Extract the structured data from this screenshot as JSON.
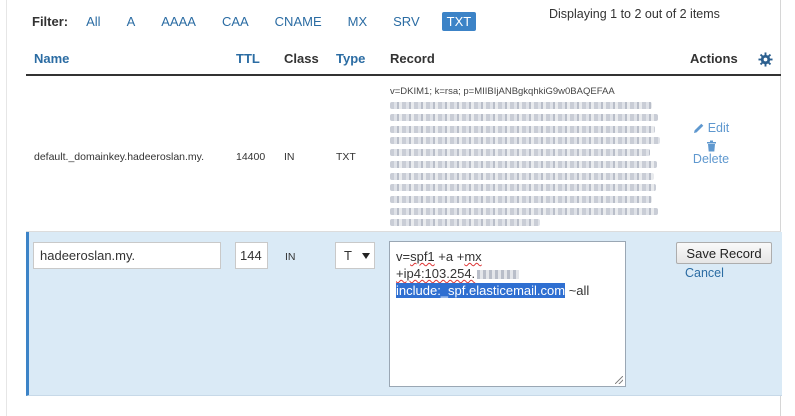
{
  "filter": {
    "label": "Filter:",
    "items": [
      "All",
      "A",
      "AAAA",
      "CAA",
      "CNAME",
      "MX",
      "SRV",
      "TXT"
    ],
    "active": "TXT"
  },
  "displaying": "Displaying 1 to 2 out of 2 items",
  "columns": {
    "name": "Name",
    "ttl": "TTL",
    "class": "Class",
    "type": "Type",
    "record": "Record",
    "actions": "Actions"
  },
  "row1": {
    "name": "default._domainkey.hadeeroslan.my.",
    "ttl": "14400",
    "class": "IN",
    "type": "TXT",
    "record_prefix": "v=DKIM1; k=rsa; p=MIIBIjANBgkqhkiG9w0BAQEFAA",
    "edit": "Edit",
    "delete": "Delete"
  },
  "edit_row": {
    "name_value": "hadeeroslan.my.",
    "ttl_value": "144",
    "class": "IN",
    "type_value": "T",
    "record_line1_a": "v=",
    "record_line1_spf": "spf1",
    "record_line1_b": " +a +",
    "record_line1_mx": "mx",
    "record_line2": "+ip4:103.254.",
    "record_include": "include:_spf.elasticemail.com",
    "record_tail": " ~all",
    "save": "Save Record",
    "cancel": "Cancel"
  },
  "colors": {
    "link": "#2b6ca3",
    "active_filter": "#3c83c7",
    "edit_row_bg": "#daeaf6",
    "selection": "#2f6fd1"
  },
  "icons": [
    "gear-icon",
    "pencil-icon",
    "trash-icon",
    "select-caret-icon"
  ]
}
